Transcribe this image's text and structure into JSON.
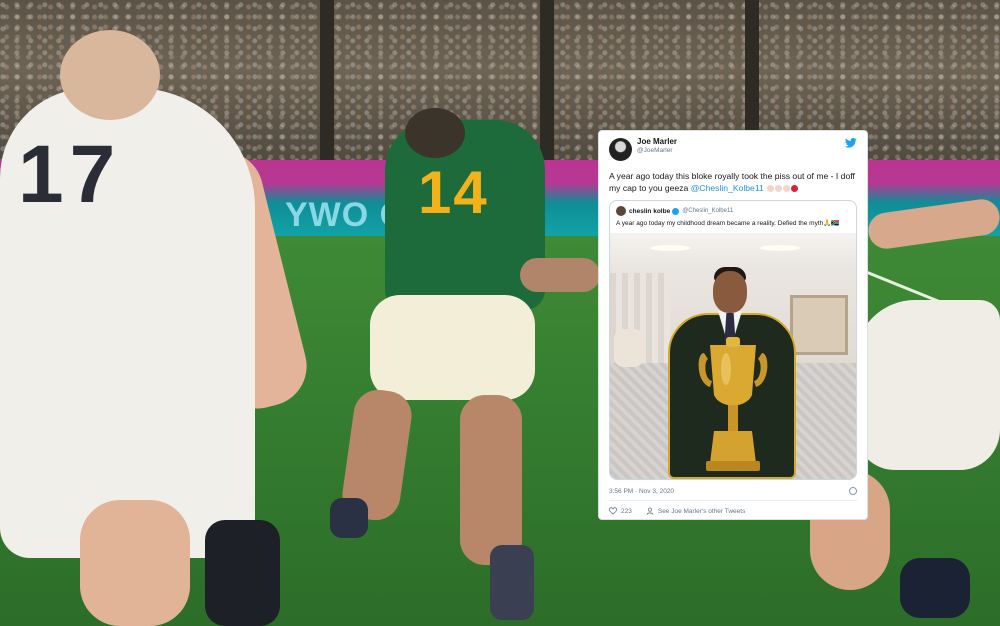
{
  "scene": {
    "ad_board_text": "YWO                    CO",
    "player_left_number": "17",
    "player_center_number": "14"
  },
  "tweet": {
    "author_name": "Joe Marler",
    "author_handle": "@JoeMarler",
    "text_before_mention": "A year ago today this bloke royally took the piss out of me - I doff my cap to you geeza ",
    "mention": "@Cheslin_Kolbe11",
    "quoted": {
      "author_name": "cheslin kolbe",
      "author_handle": "@Cheslin_Kolbe11",
      "text": "A year ago today my childhood dream became a reality. Defied the myth🙏🇿🇦"
    },
    "timestamp": "3:56 PM · Nov 3, 2020",
    "like_count": "223",
    "profile_link": "See Joe Marler's other Tweets",
    "colors": {
      "link": "#1b95e0",
      "verified": "#1da1f2"
    }
  }
}
